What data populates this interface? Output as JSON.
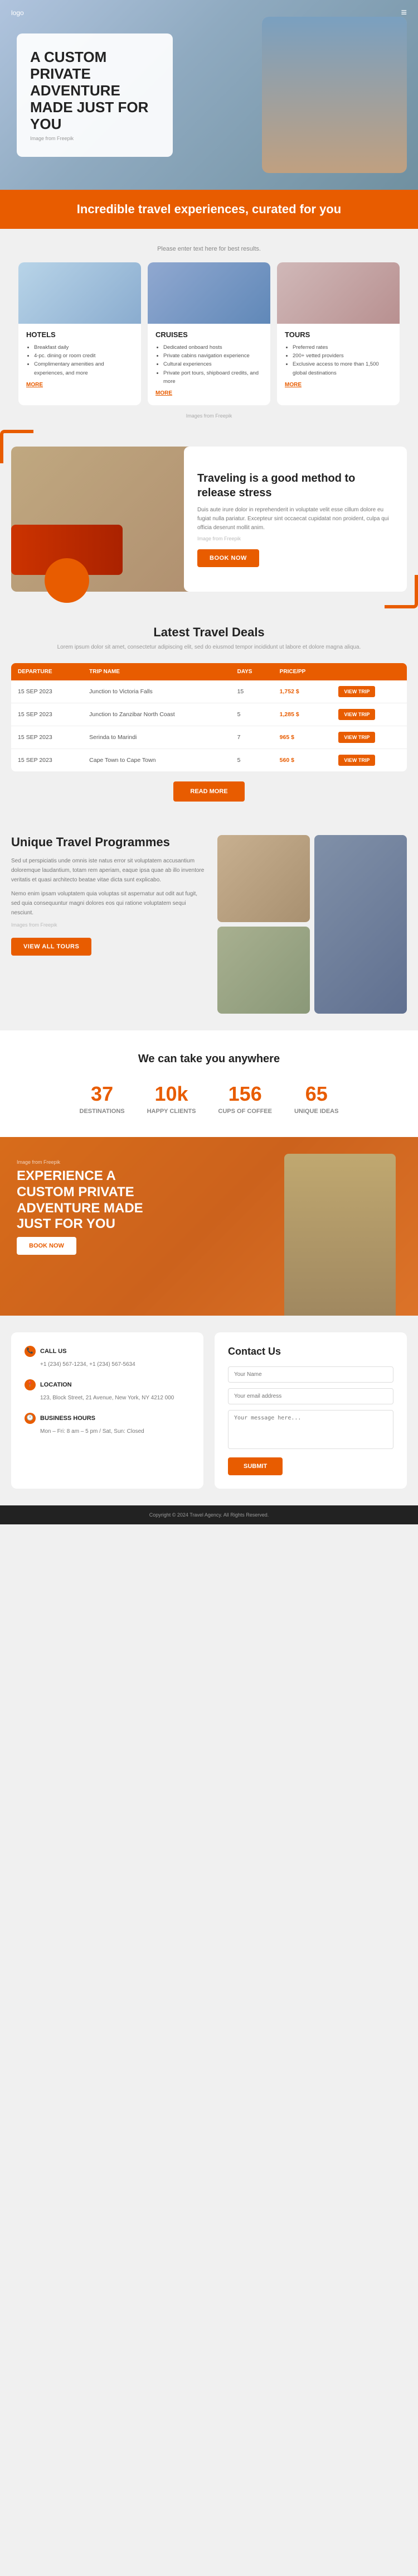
{
  "nav": {
    "logo": "logo",
    "menu_icon": "≡"
  },
  "hero": {
    "title": "A CUSTOM PRIVATE ADVENTURE MADE JUST FOR YOU",
    "img_credit": "Image from Freepik"
  },
  "banner": {
    "text": "Incredible travel experiences, curated for you"
  },
  "cards": {
    "subtitle": "Please enter text here for best results.",
    "hotels": {
      "title": "HOTELS",
      "bullets": [
        "Breakfast daily",
        "4-pc. dining or room credit",
        "Complimentary amenities and experiences, and more"
      ],
      "more": "MORE"
    },
    "cruises": {
      "title": "CRUISES",
      "bullets": [
        "Dedicated onboard hosts",
        "Private cabins navigation experience",
        "Cultural experiences",
        "Private port tours, shipboard credits, and more"
      ],
      "more": "MORE"
    },
    "tours": {
      "title": "TOURS",
      "bullets": [
        "Preferred rates",
        "200+ vetted providers",
        "Exclusive access to more than 1,500 global destinations"
      ],
      "more": "MORE"
    },
    "credit": "Images from Freepik"
  },
  "stress": {
    "title": "Traveling is a good method to release stress",
    "text": "Duis aute irure dolor in reprehenderit in voluptate velit esse cillum dolore eu fugiat nulla pariatur. Excepteur sint occaecat cupidatat non proident, culpa qui officia deserunt mollit anim.",
    "credit": "Image from Freepik",
    "book_now": "BOOK NOW"
  },
  "deals": {
    "title": "Latest Travel Deals",
    "subtitle": "Lorem ipsum dolor sit amet, consectetur adipiscing elit, sed do eiusmod tempor incididunt ut labore et dolore magna aliqua.",
    "table": {
      "headers": [
        "DEPARTURE",
        "TRIP NAME",
        "DAYS",
        "PRICE/PP"
      ],
      "rows": [
        {
          "departure": "15 SEP 2023",
          "trip_name": "Junction to Victoria Falls",
          "days": "15",
          "price": "1,752 $",
          "btn": "VIEW TRIP"
        },
        {
          "departure": "15 SEP 2023",
          "trip_name": "Junction to Zanzibar North Coast",
          "days": "5",
          "price": "1,285 $",
          "btn": "VIEW TRIP"
        },
        {
          "departure": "15 SEP 2023",
          "trip_name": "Serinda to Marindi",
          "days": "7",
          "price": "965 $",
          "btn": "VIEW TRIP"
        },
        {
          "departure": "15 SEP 2023",
          "trip_name": "Cape Town to Cape Town",
          "days": "5",
          "price": "560 $",
          "btn": "VIEW TRIP"
        }
      ]
    },
    "more_btn": "READ MORE"
  },
  "programs": {
    "title": "Unique Travel Programmes",
    "text1": "Sed ut perspiciatis unde omnis iste natus error sit voluptatem accusantium doloremque laudantium, totam rem aperiam, eaque ipsa quae ab illo inventore veritatis et quasi architecto beatae vitae dicta sunt explicabo.",
    "text2": "Nemo enim ipsam voluptatem quia voluptas sit aspernatur aut odit aut fugit, sed quia consequuntur magni dolores eos qui ratione voluptatem sequi nesciunt.",
    "credit": "Images from Freepik",
    "view_btn": "VIEW ALL TOURS"
  },
  "stats": {
    "title": "We can take you anywhere",
    "items": [
      {
        "number": "37",
        "label": "DESTINATIONS"
      },
      {
        "number": "10k",
        "label": "HAPPY CLIENTS"
      },
      {
        "number": "156",
        "label": "CUPS OF COFFEE"
      },
      {
        "number": "65",
        "label": "UNIQUE IDEAS"
      }
    ]
  },
  "adventure": {
    "credit": "Image from Freepik",
    "title": "Experience a Custom Private Adventure Made Just for You",
    "book_btn": "BOOK NOW"
  },
  "contact": {
    "left": {
      "call_label": "CALL US",
      "call_text": "+1 (234) 567-1234, +1 (234) 567-5634",
      "location_label": "LOCATION",
      "location_text": "123, Block Street, 21 Avenue, New York, NY\n4212 000",
      "hours_label": "BUSINESS HOURS",
      "hours_text": "Mon – Fri: 8 am – 5 pm / Sat, Sun: Closed"
    },
    "right": {
      "title": "Contact Us",
      "name_placeholder": "Your Name",
      "email_placeholder": "Your email address",
      "message_placeholder": "Your message here...",
      "submit_label": "SUBMIT"
    }
  },
  "footer": {
    "text": "Copyright © 2024 Travel Agency. All Rights Reserved."
  }
}
